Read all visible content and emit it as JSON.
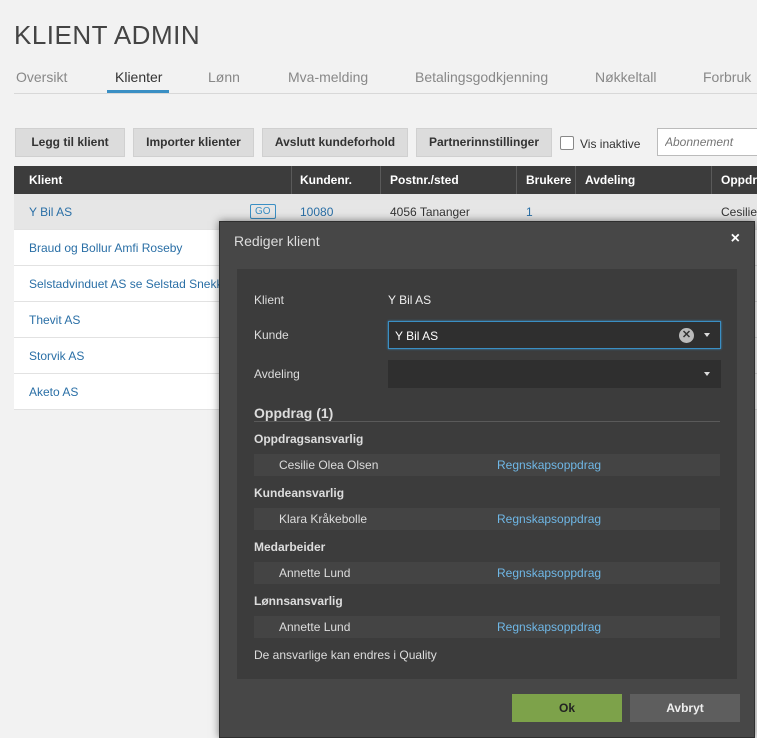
{
  "page_title": "KLIENT ADMIN",
  "tabs": [
    {
      "label": "Oversikt"
    },
    {
      "label": "Klienter"
    },
    {
      "label": "Lønn"
    },
    {
      "label": "Mva-melding"
    },
    {
      "label": "Betalingsgodkjenning"
    },
    {
      "label": "Nøkkeltall"
    },
    {
      "label": "Forbruk"
    }
  ],
  "toolbar": {
    "add_client": "Legg til klient",
    "import_clients": "Importer klienter",
    "end_relationship": "Avslutt kundeforhold",
    "partner_settings": "Partnerinnstillinger",
    "show_inactive": "Vis inaktive",
    "subscription_placeholder": "Abonnement"
  },
  "grid": {
    "headers": [
      "Klient",
      "Kundenr.",
      "Postnr./sted",
      "Brukere",
      "Avdeling",
      "Oppdr"
    ],
    "go_badge": "GO",
    "rows": [
      {
        "name": "Y Bil AS",
        "kundenr": "10080",
        "sted": "4056 Tananger",
        "brukere": "1",
        "oppdrag": "Cesilie"
      },
      {
        "name": "Braud og Bollur Amfi Roseby"
      },
      {
        "name": "Selstadvinduet AS se Selstad Snekkeri"
      },
      {
        "name": "Thevit AS"
      },
      {
        "name": "Storvik AS"
      },
      {
        "name": "Aketo AS"
      }
    ]
  },
  "modal": {
    "title": "Rediger klient",
    "close": "×",
    "klient_label": "Klient",
    "klient_value": "Y Bil AS",
    "kunde_label": "Kunde",
    "kunde_value": "Y Bil AS",
    "clear_glyph": "✕",
    "avdeling_label": "Avdeling",
    "avdeling_value": "",
    "section_title": "Oppdrag (1)",
    "roles": [
      {
        "title": "Oppdragsansvarlig",
        "person": "Cesilie Olea Olsen",
        "assignment": "Regnskapsoppdrag"
      },
      {
        "title": "Kundeansvarlig",
        "person": "Klara Kråkebolle",
        "assignment": "Regnskapsoppdrag"
      },
      {
        "title": "Medarbeider",
        "person": "Annette Lund",
        "assignment": "Regnskapsoppdrag"
      },
      {
        "title": "Lønnsansvarlig",
        "person": "Annette Lund",
        "assignment": "Regnskapsoppdrag"
      }
    ],
    "footnote": "De ansvarlige kan endres i Quality",
    "ok_label": "Ok",
    "cancel_label": "Avbryt"
  },
  "colors": {
    "accent": "#3a8fc4",
    "ok_button": "#7da24a",
    "link": "#2a6fa6",
    "modal_link": "#6fb7e6",
    "header_bg": "#3c3c3c",
    "modal_bg": "#474747"
  }
}
